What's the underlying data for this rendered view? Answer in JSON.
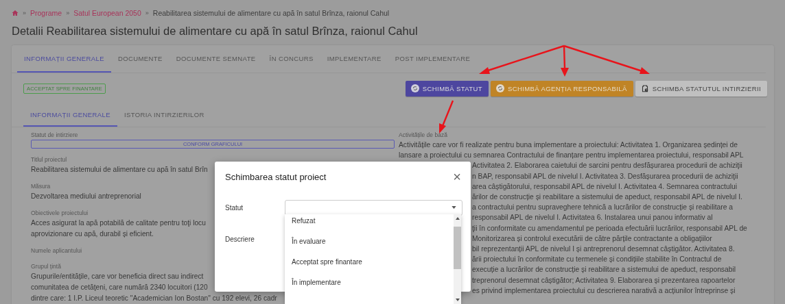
{
  "breadcrumb_separator": "»",
  "breadcrumb": [
    {
      "label": "Programe",
      "kind": "link"
    },
    {
      "label": "Satul European 2050",
      "kind": "link"
    },
    {
      "label": "Reabilitarea sistemului de alimentare cu apă în satul Brînza, raionul Cahul",
      "kind": "current"
    }
  ],
  "page_title": "Detalii Reabilitarea sistemului de alimentare cu apă în satul Brînza, raionul Cahul",
  "tabs": [
    {
      "label": "INFORMAȚII GENERALE",
      "selected": true
    },
    {
      "label": "DOCUMENTE",
      "selected": false
    },
    {
      "label": "DOCUMENTE SEMNATE",
      "selected": false
    },
    {
      "label": "ÎN CONCURS",
      "selected": false
    },
    {
      "label": "IMPLEMENTARE",
      "selected": false
    },
    {
      "label": "POST IMPLEMENTARE",
      "selected": false
    }
  ],
  "status_badge": "ACCEPTAT SPRE FINANTARE",
  "actions": [
    {
      "label": "SCHIMBĂ STATUT",
      "kind": "primary"
    },
    {
      "label": "SCHIMBĂ AGENȚIA RESPONSABILĂ",
      "kind": "warning"
    },
    {
      "label": "SCHIMBA STATUTUL INTIRZIERII",
      "kind": "default"
    }
  ],
  "subtabs": [
    {
      "label": "INFORMAȚII GENERALE",
      "selected": true
    },
    {
      "label": "ISTORIA INTIRZIERILOR",
      "selected": false
    }
  ],
  "left_fields": [
    {
      "label": "Statut de intirziere",
      "kind": "badge",
      "lines": [
        "CONFORM GRAFICULUI"
      ]
    },
    {
      "label": "Titlul proiectul",
      "kind": "text",
      "lines": [
        "Reabilitarea sistemului de alimentare cu apă în satul Brîn"
      ]
    },
    {
      "label": "Măsura",
      "kind": "text",
      "lines": [
        "Dezvoltarea mediului antreprenorial"
      ]
    },
    {
      "label": "Obiectivele proiectului",
      "kind": "text",
      "lines": [
        "Acces asigurat la apă potabilă de calitate pentru toţi locu",
        "aprovizionare cu apă, durabil și eficient."
      ]
    },
    {
      "label": "Numele aplicantului",
      "kind": "text"
    },
    {
      "label": "Grupul țintă",
      "kind": "text",
      "lines": [
        "Grupurile/entitățile, care vor beneficia direct sau indirect",
        "comunitatea de cetăţeni, care numără 2340 locuitori (120",
        "dintre care: 1 I.P. Liceul teoretic \"Academician Ion Bostan\" cu 192 elevi, 26 cadr"
      ]
    }
  ],
  "activities": {
    "label": "Activitățile de bază",
    "lines": [
      {
        "text": "Activitățile care vor fi realizate pentru buna implementare a proiectului: Activitatea 1. Organizarea ședinței de",
        "kind": "full"
      },
      {
        "text": "lansare a proiectului cu semnarea Contractului de finanțare pentru implementarea proiectului, responsabil APL",
        "kind": "full"
      },
      {
        "text": "Activitatea 2. Elaborarea caietului de sarcini pentru desfășurarea procedurii de achiziţii",
        "kind": "partial"
      },
      {
        "text": "n BAP, responsabil APL de nivelul I. Activitatea 3. Desfășurarea procedurii de achiziţii",
        "kind": "partial"
      },
      {
        "text": "area câștigătorului, responsabil APL de nivelul I. Activitatea 4. Semnarea contractului",
        "kind": "partial"
      },
      {
        "text": "ărilor de construcție și reabilitare a sistemului de apeduct, responsabil APL de nivelul I.",
        "kind": "partial"
      },
      {
        "text": "a contractului pentru supraveghere tehnică a lucrărilor de construcție și reabilitare a",
        "kind": "partial"
      },
      {
        "text": "responsabil APL de nivelul I. Activitatea 6. Instalarea unui panou informativ al",
        "kind": "partial"
      },
      {
        "text": "ţii în conformitate cu amendamentul pe perioada efectuării lucrărilor, responsabil APL de",
        "kind": "partial"
      },
      {
        "text": "Monitorizarea și controlul executării de către părțile contractante a obligațiilor",
        "kind": "partial"
      },
      {
        "text": "bil reprezentanții APL de nivelul I și antreprenorul desemnat câștigător. Activitatea 8.",
        "kind": "partial"
      },
      {
        "text": "ării proiectului în conformitate cu termenele și condițiile stabilite în Contractul de",
        "kind": "partial"
      },
      {
        "text": "execuție a lucrărilor de construcție și reabilitare a sistemului de apeduct, responsabil",
        "kind": "partial"
      },
      {
        "text": "treprenorul desemnat câștigător; Activitatea 9. Elaborarea și prezentarea rapoartelor",
        "kind": "partial"
      },
      {
        "text": "es privind implementarea proiectului cu descrierea narativă a acțiunilor întreprinse și",
        "kind": "partial"
      }
    ]
  },
  "dialog": {
    "title": "Schimbarea statut proiect",
    "close": "×",
    "fields": [
      {
        "label": "Statut",
        "kind": "select"
      },
      {
        "label": "Descriere",
        "kind": "textarea"
      }
    ],
    "options": [
      {
        "label": "Refuzat",
        "selected": false
      },
      {
        "label": "În evaluare",
        "selected": false
      },
      {
        "label": "Acceptat spre finantare",
        "selected": false
      },
      {
        "label": "În implementare",
        "selected": false
      }
    ]
  }
}
